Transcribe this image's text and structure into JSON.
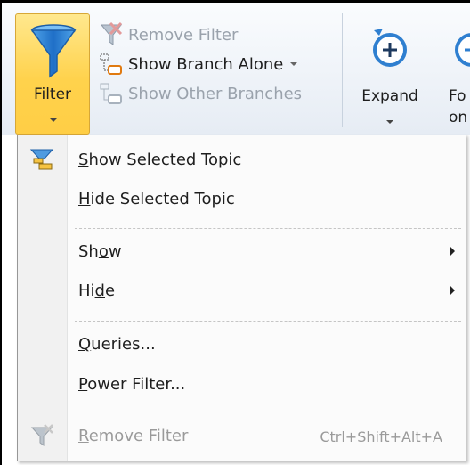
{
  "ribbon": {
    "filter": {
      "label": "Filter",
      "icon": "funnel-icon"
    },
    "remove_filter": {
      "label": "Remove Filter",
      "icon": "remove-filter-icon",
      "enabled": false
    },
    "show_branch_alone": {
      "label": "Show Branch Alone",
      "icon": "branch-icon",
      "enabled": true
    },
    "show_other_branches": {
      "label": "Show Other Branches",
      "icon": "branches-icon",
      "enabled": false
    },
    "expand": {
      "label": "Expand",
      "icon": "expand-plus-icon"
    },
    "focus": {
      "label_line1": "Fo",
      "label_line2": "on T",
      "icon": "focus-icon"
    }
  },
  "menu": {
    "items": [
      {
        "pre": "",
        "accel": "S",
        "post": "how Selected Topic",
        "icon": "show-selected-topic-icon"
      },
      {
        "pre": "",
        "accel": "H",
        "post": "ide Selected Topic"
      },
      {
        "pre": "Sh",
        "accel": "o",
        "post": "w",
        "submenu": true
      },
      {
        "pre": "Hi",
        "accel": "d",
        "post": "e",
        "submenu": true
      },
      {
        "pre": "",
        "accel": "Q",
        "post": "ueries..."
      },
      {
        "pre": "",
        "accel": "P",
        "post": "ower Filter..."
      },
      {
        "pre": "",
        "accel": "R",
        "post": "emove Filter",
        "shortcut": "Ctrl+Shift+Alt+A",
        "enabled": false,
        "icon": "remove-filter-icon"
      }
    ]
  },
  "colors": {
    "active_button": "#ffd24c",
    "ribbon_bg": "#e6ecf4",
    "icon_blue": "#2f7fd0",
    "disabled_text": "#9a9a9a"
  }
}
